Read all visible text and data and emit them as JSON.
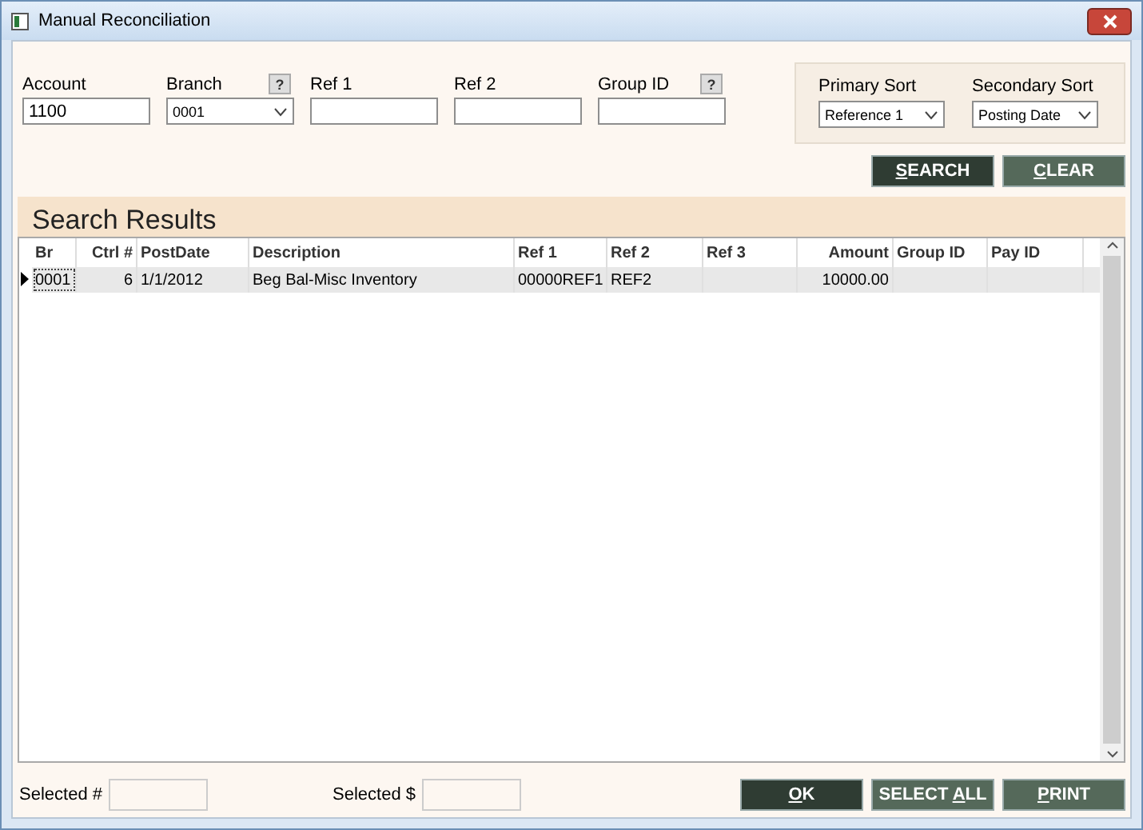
{
  "window": {
    "title": "Manual Reconciliation"
  },
  "filters": [
    {
      "kind": "text",
      "label": "Account",
      "value": "1100"
    },
    {
      "kind": "dropdown",
      "label": "Branch",
      "value": "0001",
      "help_text": "?"
    },
    {
      "kind": "text",
      "label": "Ref 1"
    },
    {
      "kind": "text",
      "label": "Ref 2"
    },
    {
      "kind": "text",
      "label": "Group ID",
      "help_text": "?"
    }
  ],
  "sorts": [
    {
      "label": "Primary Sort",
      "value": "Reference 1"
    },
    {
      "label": "Secondary Sort",
      "value": "Posting Date"
    }
  ],
  "search_buttons": [
    {
      "key": "S",
      "after": "EARCH",
      "primary": true
    },
    {
      "key": "C",
      "after": "LEAR",
      "primary": false
    }
  ],
  "results": {
    "title": "Search Results",
    "columns": [
      {
        "label": "Br",
        "kind": "text"
      },
      {
        "label": "Ctrl #",
        "kind": "number"
      },
      {
        "label": "PostDate",
        "kind": "text"
      },
      {
        "label": "Description",
        "kind": "text"
      },
      {
        "label": "Ref 1",
        "kind": "text"
      },
      {
        "label": "Ref 2",
        "kind": "text"
      },
      {
        "label": "Ref 3",
        "kind": "text"
      },
      {
        "label": "Amount",
        "kind": "number"
      },
      {
        "label": "Group ID",
        "kind": "text"
      },
      {
        "label": "Pay ID",
        "kind": "text"
      }
    ],
    "rows": [
      {
        "selected": true,
        "cells": [
          "0001",
          "6",
          "1/1/2012",
          "Beg Bal-Misc Inventory",
          "00000REF1",
          "REF2",
          null,
          "10000.00",
          null,
          null
        ]
      }
    ]
  },
  "footer_fields": [
    {
      "label": "Selected #"
    },
    {
      "label": "Selected $"
    }
  ],
  "footer_buttons": [
    {
      "key": "O",
      "after": "K",
      "primary": true
    },
    {
      "before": "SELECT ",
      "key": "A",
      "after": "LL",
      "primary": false
    },
    {
      "key": "P",
      "after": "RINT",
      "primary": false
    }
  ]
}
